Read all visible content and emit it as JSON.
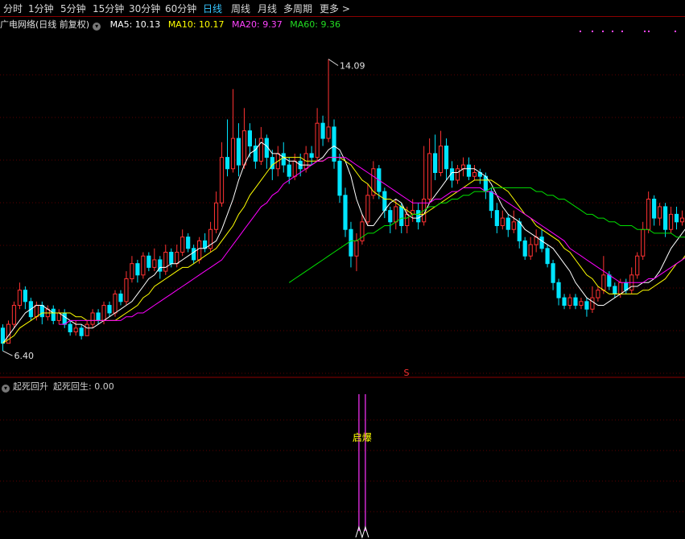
{
  "toolbar": {
    "periods": [
      "分时",
      "1分钟",
      "5分钟",
      "15分钟",
      "30分钟",
      "60分钟",
      "日线",
      "周线",
      "月线",
      "多周期",
      "更多 >"
    ],
    "active": "日线"
  },
  "main_legend": {
    "title": "广电网络(日线 前复权)",
    "ma5": "MA5: 10.13",
    "ma10": "MA10: 10.17",
    "ma20": "MA20: 9.37",
    "ma60": "MA60: 9.36"
  },
  "sub_legend": {
    "indicator": "起死回升",
    "value": "起死回生: 0.00"
  },
  "colors": {
    "up": "#ff3232",
    "down": "#00e5ff",
    "ma5": "#ffffff",
    "ma10": "#ffff00",
    "ma20": "#ff00ff",
    "ma60": "#00e000",
    "grid": "#5a0000",
    "signal": "#ffff00"
  },
  "chart_data": {
    "type": "candlestick",
    "price_axis": {
      "ylim": [
        6.0,
        14.8
      ]
    },
    "annotations": {
      "high_label": "14.09",
      "low_label": "6.40",
      "marker": "S",
      "signal_text": "启爆"
    },
    "candles": [
      [
        7.0,
        6.6,
        7.1,
        6.4
      ],
      [
        6.6,
        7.1,
        7.2,
        6.6
      ],
      [
        7.1,
        7.6,
        7.7,
        7.0
      ],
      [
        7.6,
        8.0,
        8.2,
        7.5
      ],
      [
        8.0,
        7.7,
        8.1,
        7.5
      ],
      [
        7.7,
        7.3,
        7.8,
        7.2
      ],
      [
        7.3,
        7.6,
        7.7,
        7.2
      ],
      [
        7.6,
        7.3,
        7.7,
        7.1
      ],
      [
        7.3,
        7.5,
        7.6,
        7.2
      ],
      [
        7.5,
        7.2,
        7.6,
        7.1
      ],
      [
        7.2,
        7.4,
        7.5,
        7.1
      ],
      [
        7.4,
        7.1,
        7.5,
        7.0
      ],
      [
        7.1,
        6.9,
        7.2,
        6.8
      ],
      [
        6.9,
        7.0,
        7.2,
        6.8
      ],
      [
        7.0,
        6.8,
        7.1,
        6.7
      ],
      [
        6.8,
        7.1,
        7.2,
        6.8
      ],
      [
        7.1,
        7.4,
        7.5,
        7.0
      ],
      [
        7.4,
        7.2,
        7.5,
        7.1
      ],
      [
        7.2,
        7.6,
        7.7,
        7.1
      ],
      [
        7.6,
        7.4,
        7.7,
        7.3
      ],
      [
        7.4,
        7.9,
        8.0,
        7.3
      ],
      [
        7.9,
        7.7,
        8.0,
        7.6
      ],
      [
        7.7,
        8.3,
        8.5,
        7.6
      ],
      [
        8.3,
        8.7,
        8.9,
        8.2
      ],
      [
        8.7,
        8.4,
        8.8,
        8.2
      ],
      [
        8.4,
        8.9,
        9.0,
        8.3
      ],
      [
        8.9,
        8.6,
        9.0,
        8.5
      ],
      [
        8.6,
        8.8,
        9.1,
        8.5
      ],
      [
        8.8,
        8.5,
        8.9,
        8.3
      ],
      [
        8.5,
        9.0,
        9.2,
        8.4
      ],
      [
        9.0,
        8.7,
        9.1,
        8.6
      ],
      [
        8.7,
        9.0,
        9.2,
        8.6
      ],
      [
        9.0,
        9.4,
        9.6,
        8.9
      ],
      [
        9.4,
        9.1,
        9.5,
        9.0
      ],
      [
        9.1,
        8.8,
        9.2,
        8.7
      ],
      [
        8.8,
        9.3,
        9.4,
        8.7
      ],
      [
        9.3,
        9.1,
        9.5,
        9.0
      ],
      [
        9.1,
        9.6,
        9.8,
        9.0
      ],
      [
        9.6,
        10.3,
        10.6,
        9.5
      ],
      [
        10.3,
        11.5,
        11.9,
        10.2
      ],
      [
        11.5,
        11.2,
        12.5,
        11.0
      ],
      [
        11.2,
        12.0,
        13.3,
        11.1
      ],
      [
        12.0,
        11.3,
        12.4,
        11.0
      ],
      [
        11.3,
        12.2,
        12.8,
        11.2
      ],
      [
        12.2,
        11.8,
        12.4,
        11.5
      ],
      [
        11.8,
        11.4,
        12.0,
        11.2
      ],
      [
        11.4,
        12.0,
        12.3,
        11.3
      ],
      [
        12.0,
        11.5,
        12.1,
        11.2
      ],
      [
        11.5,
        11.2,
        11.7,
        10.9
      ],
      [
        11.2,
        11.6,
        11.8,
        11.0
      ],
      [
        11.6,
        11.3,
        11.9,
        11.1
      ],
      [
        11.3,
        11.0,
        11.5,
        10.8
      ],
      [
        11.0,
        11.4,
        11.6,
        10.9
      ],
      [
        11.4,
        11.2,
        11.6,
        11.0
      ],
      [
        11.2,
        11.6,
        11.8,
        11.1
      ],
      [
        11.6,
        11.5,
        11.8,
        11.3
      ],
      [
        11.5,
        12.4,
        12.8,
        11.4
      ],
      [
        12.4,
        12.0,
        12.6,
        11.8
      ],
      [
        12.0,
        12.3,
        14.09,
        11.9
      ],
      [
        12.3,
        11.4,
        12.5,
        11.2
      ],
      [
        11.4,
        10.5,
        11.6,
        10.3
      ],
      [
        10.5,
        9.6,
        10.7,
        9.4
      ],
      [
        9.6,
        8.9,
        9.8,
        8.6
      ],
      [
        8.9,
        9.3,
        9.5,
        8.5
      ],
      [
        9.3,
        9.8,
        10.0,
        9.2
      ],
      [
        9.8,
        10.5,
        10.8,
        9.7
      ],
      [
        10.5,
        11.2,
        11.4,
        10.4
      ],
      [
        11.2,
        10.6,
        11.3,
        10.4
      ],
      [
        10.6,
        10.1,
        10.7,
        9.9
      ],
      [
        10.1,
        9.8,
        10.2,
        9.5
      ],
      [
        9.8,
        10.2,
        10.4,
        9.6
      ],
      [
        10.2,
        9.7,
        10.3,
        9.5
      ],
      [
        9.7,
        10.0,
        10.2,
        9.5
      ],
      [
        10.0,
        10.1,
        10.4,
        9.8
      ],
      [
        10.1,
        9.8,
        10.3,
        9.6
      ],
      [
        9.8,
        10.4,
        11.8,
        9.7
      ],
      [
        10.4,
        11.6,
        12.0,
        10.3
      ],
      [
        11.6,
        11.1,
        12.1,
        10.9
      ],
      [
        11.1,
        11.8,
        12.2,
        11.0
      ],
      [
        11.8,
        11.2,
        12.0,
        10.9
      ],
      [
        11.2,
        10.9,
        11.4,
        10.7
      ],
      [
        10.9,
        11.2,
        11.3,
        10.8
      ],
      [
        11.2,
        11.3,
        11.5,
        11.0
      ],
      [
        11.3,
        11.0,
        11.5,
        10.9
      ],
      [
        11.0,
        11.1,
        11.3,
        10.9
      ],
      [
        11.1,
        11.0,
        11.2,
        10.8
      ],
      [
        11.0,
        10.6,
        11.1,
        10.4
      ],
      [
        10.6,
        10.1,
        10.7,
        9.9
      ],
      [
        10.1,
        9.7,
        10.3,
        9.5
      ],
      [
        9.7,
        9.9,
        10.1,
        9.6
      ],
      [
        9.9,
        9.6,
        10.0,
        9.4
      ],
      [
        9.6,
        9.8,
        10.1,
        9.5
      ],
      [
        9.8,
        9.3,
        9.9,
        9.1
      ],
      [
        9.3,
        8.9,
        9.4,
        8.8
      ],
      [
        8.9,
        9.2,
        9.4,
        8.8
      ],
      [
        9.2,
        9.4,
        9.6,
        9.0
      ],
      [
        9.4,
        9.1,
        9.6,
        9.0
      ],
      [
        9.1,
        8.7,
        9.2,
        8.6
      ],
      [
        8.7,
        8.2,
        8.8,
        8.0
      ],
      [
        8.2,
        7.8,
        8.3,
        7.6
      ],
      [
        7.8,
        7.6,
        7.9,
        7.5
      ],
      [
        7.6,
        7.8,
        7.9,
        7.5
      ],
      [
        7.8,
        7.6,
        7.9,
        7.5
      ],
      [
        7.6,
        7.7,
        7.8,
        7.5
      ],
      [
        7.7,
        7.5,
        7.8,
        7.3
      ],
      [
        7.5,
        7.8,
        8.1,
        7.4
      ],
      [
        7.8,
        8.0,
        8.1,
        7.7
      ],
      [
        8.0,
        8.4,
        8.9,
        7.9
      ],
      [
        8.4,
        8.1,
        8.5,
        8.0
      ],
      [
        8.1,
        7.9,
        8.2,
        7.8
      ],
      [
        7.9,
        8.2,
        8.3,
        7.8
      ],
      [
        8.2,
        8.0,
        8.3,
        7.9
      ],
      [
        8.0,
        8.4,
        8.6,
        7.9
      ],
      [
        8.4,
        8.9,
        9.0,
        8.3
      ],
      [
        8.9,
        9.6,
        9.8,
        8.8
      ],
      [
        9.6,
        10.4,
        10.6,
        9.5
      ],
      [
        10.4,
        9.9,
        10.5,
        9.7
      ],
      [
        9.9,
        10.2,
        10.3,
        9.7
      ],
      [
        10.2,
        9.6,
        10.3,
        9.4
      ],
      [
        9.6,
        10.0,
        10.2,
        9.5
      ],
      [
        10.0,
        9.8,
        10.2,
        9.6
      ],
      [
        9.8,
        9.9,
        10.1,
        9.7
      ]
    ],
    "ma": {
      "ma5": [
        6.6,
        6.8,
        7.0,
        7.2,
        7.4,
        7.5,
        7.6,
        7.6,
        7.5,
        7.4,
        7.4,
        7.3,
        7.2,
        7.1,
        7.1,
        7.0,
        7.0,
        7.1,
        7.2,
        7.3,
        7.4,
        7.5,
        7.6,
        7.7,
        7.9,
        8.1,
        8.3,
        8.4,
        8.6,
        8.6,
        8.7,
        8.7,
        8.8,
        8.9,
        9.0,
        9.1,
        9.1,
        9.2,
        9.3,
        9.6,
        10.0,
        10.4,
        10.9,
        11.3,
        11.6,
        11.7,
        11.9,
        11.8,
        11.6,
        11.6,
        11.5,
        11.4,
        11.4,
        11.3,
        11.3,
        11.3,
        11.4,
        11.5,
        11.7,
        11.8,
        11.7,
        11.4,
        11.0,
        10.4,
        10.0,
        9.7,
        9.7,
        9.9,
        10.1,
        10.3,
        10.4,
        10.3,
        10.0,
        9.9,
        9.9,
        10.0,
        10.3,
        10.5,
        10.7,
        10.9,
        11.1,
        11.1,
        11.2,
        11.2,
        11.2,
        11.1,
        11.0,
        10.8,
        10.5,
        10.2,
        10.0,
        9.9,
        9.8,
        9.6,
        9.5,
        9.4,
        9.3,
        9.2,
        9.1,
        8.9,
        8.7,
        8.5,
        8.2,
        8.0,
        7.8,
        7.7,
        7.6,
        7.6,
        7.7,
        7.8,
        7.9,
        8.0,
        8.1,
        8.1,
        8.2,
        8.2,
        8.3,
        8.5,
        8.8,
        9.1,
        9.3,
        9.5,
        9.7,
        9.8,
        9.9,
        9.9,
        9.9
      ],
      "ma10": [
        6.6,
        6.7,
        6.8,
        7.0,
        7.1,
        7.2,
        7.3,
        7.4,
        7.4,
        7.4,
        7.4,
        7.4,
        7.4,
        7.3,
        7.3,
        7.2,
        7.2,
        7.2,
        7.2,
        7.2,
        7.2,
        7.3,
        7.4,
        7.5,
        7.6,
        7.8,
        7.9,
        8.1,
        8.2,
        8.3,
        8.4,
        8.5,
        8.6,
        8.6,
        8.7,
        8.8,
        8.9,
        9.0,
        9.1,
        9.3,
        9.5,
        9.7,
        10.0,
        10.2,
        10.5,
        10.7,
        10.9,
        11.1,
        11.3,
        11.4,
        11.5,
        11.5,
        11.5,
        11.5,
        11.4,
        11.4,
        11.4,
        11.4,
        11.5,
        11.5,
        11.5,
        11.4,
        11.3,
        11.1,
        10.9,
        10.8,
        10.6,
        10.5,
        10.4,
        10.4,
        10.3,
        10.2,
        10.1,
        10.0,
        10.0,
        10.0,
        10.1,
        10.2,
        10.3,
        10.4,
        10.5,
        10.6,
        10.7,
        10.8,
        10.9,
        10.9,
        10.9,
        10.9,
        10.8,
        10.7,
        10.6,
        10.4,
        10.2,
        10.0,
        9.9,
        9.7,
        9.6,
        9.5,
        9.4,
        9.3,
        9.1,
        9.0,
        8.8,
        8.6,
        8.4,
        8.3,
        8.1,
        8.0,
        7.9,
        7.9,
        7.9,
        7.9,
        7.9,
        7.9,
        8.0,
        8.0,
        8.1,
        8.2,
        8.3,
        8.5,
        8.7,
        8.8,
        9.0,
        9.1,
        9.3,
        9.4,
        9.5
      ],
      "ma20": [
        null,
        null,
        null,
        null,
        null,
        null,
        null,
        null,
        null,
        null,
        7.1,
        7.1,
        7.2,
        7.2,
        7.2,
        7.2,
        7.2,
        7.2,
        7.2,
        7.2,
        7.2,
        7.2,
        7.3,
        7.3,
        7.4,
        7.4,
        7.5,
        7.6,
        7.7,
        7.8,
        7.9,
        8.0,
        8.1,
        8.2,
        8.3,
        8.4,
        8.5,
        8.6,
        8.7,
        8.8,
        9.0,
        9.2,
        9.4,
        9.6,
        9.8,
        10.0,
        10.2,
        10.3,
        10.5,
        10.6,
        10.8,
        10.9,
        11.0,
        11.1,
        11.2,
        11.3,
        11.4,
        11.4,
        11.5,
        11.5,
        11.5,
        11.5,
        11.4,
        11.3,
        11.2,
        11.1,
        11.0,
        10.9,
        10.8,
        10.7,
        10.6,
        10.5,
        10.4,
        10.3,
        10.3,
        10.3,
        10.3,
        10.4,
        10.4,
        10.5,
        10.6,
        10.6,
        10.7,
        10.7,
        10.7,
        10.7,
        10.6,
        10.6,
        10.5,
        10.4,
        10.3,
        10.2,
        10.1,
        10.0,
        9.9,
        9.8,
        9.7,
        9.6,
        9.5,
        9.4,
        9.3,
        9.1,
        9.0,
        8.9,
        8.8,
        8.7,
        8.6,
        8.5,
        8.4,
        8.3,
        8.2,
        8.2,
        8.2,
        8.2,
        8.2,
        8.3,
        8.3,
        8.4,
        8.5,
        8.6,
        8.7,
        8.8,
        8.9,
        9.0,
        9.1,
        9.2,
        9.37
      ],
      "ma60": [
        null,
        null,
        null,
        null,
        null,
        null,
        null,
        null,
        null,
        null,
        null,
        null,
        null,
        null,
        null,
        null,
        null,
        null,
        null,
        null,
        null,
        null,
        null,
        null,
        null,
        null,
        null,
        null,
        null,
        null,
        null,
        null,
        null,
        null,
        null,
        null,
        null,
        null,
        null,
        null,
        null,
        null,
        null,
        null,
        null,
        null,
        null,
        null,
        null,
        null,
        null,
        8.2,
        8.3,
        8.4,
        8.5,
        8.6,
        8.7,
        8.8,
        8.9,
        9.0,
        9.1,
        9.2,
        9.3,
        9.3,
        9.4,
        9.5,
        9.5,
        9.6,
        9.7,
        9.7,
        9.8,
        9.9,
        9.9,
        10.0,
        10.0,
        10.1,
        10.2,
        10.2,
        10.3,
        10.3,
        10.4,
        10.4,
        10.5,
        10.5,
        10.6,
        10.6,
        10.6,
        10.7,
        10.7,
        10.7,
        10.7,
        10.7,
        10.7,
        10.7,
        10.7,
        10.6,
        10.6,
        10.5,
        10.5,
        10.4,
        10.4,
        10.3,
        10.2,
        10.1,
        10.0,
        10.0,
        9.9,
        9.9,
        9.8,
        9.8,
        9.7,
        9.7,
        9.7,
        9.6,
        9.6,
        9.6,
        9.5,
        9.5,
        9.5,
        9.5,
        9.4,
        9.4,
        9.4,
        9.36,
        9.36,
        9.36
      ]
    },
    "signal": {
      "index": 64,
      "value": 0.0
    }
  }
}
